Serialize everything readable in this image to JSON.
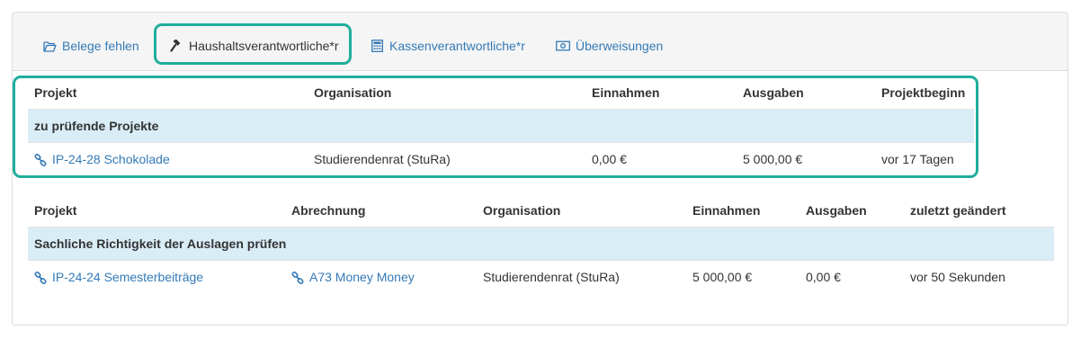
{
  "tabs": [
    {
      "label": "Belege fehlen",
      "icon": "folder-open-icon"
    },
    {
      "label": "Haushaltsverantwortliche*r",
      "icon": "gavel-icon"
    },
    {
      "label": "Kassenverantwortliche*r",
      "icon": "calculator-icon"
    },
    {
      "label": "Überweisungen",
      "icon": "money-icon"
    }
  ],
  "table1": {
    "headers": [
      "Projekt",
      "Organisation",
      "Einnahmen",
      "Ausgaben",
      "Projektbeginn"
    ],
    "group_label": "zu prüfende Projekte",
    "rows": [
      {
        "projekt": "IP-24-28 Schokolade",
        "organisation": "Studierendenrat (StuRa)",
        "einnahmen": "0,00 €",
        "ausgaben": "5 000,00 €",
        "projektbeginn": "vor 17 Tagen"
      }
    ]
  },
  "table2": {
    "headers": [
      "Projekt",
      "Abrechnung",
      "Organisation",
      "Einnahmen",
      "Ausgaben",
      "zuletzt geändert"
    ],
    "group_label": "Sachliche Richtigkeit der Auslagen prüfen",
    "rows": [
      {
        "projekt": "IP-24-24 Semesterbeiträge",
        "abrechnung": "A73 Money Money",
        "organisation": "Studierendenrat (StuRa)",
        "einnahmen": "5 000,00 €",
        "ausgaben": "0,00 €",
        "zuletzt": "vor 50 Sekunden"
      }
    ]
  },
  "colors": {
    "link": "#337ab7",
    "highlight": "#1fae9b",
    "group_bg": "#d9edf7"
  }
}
